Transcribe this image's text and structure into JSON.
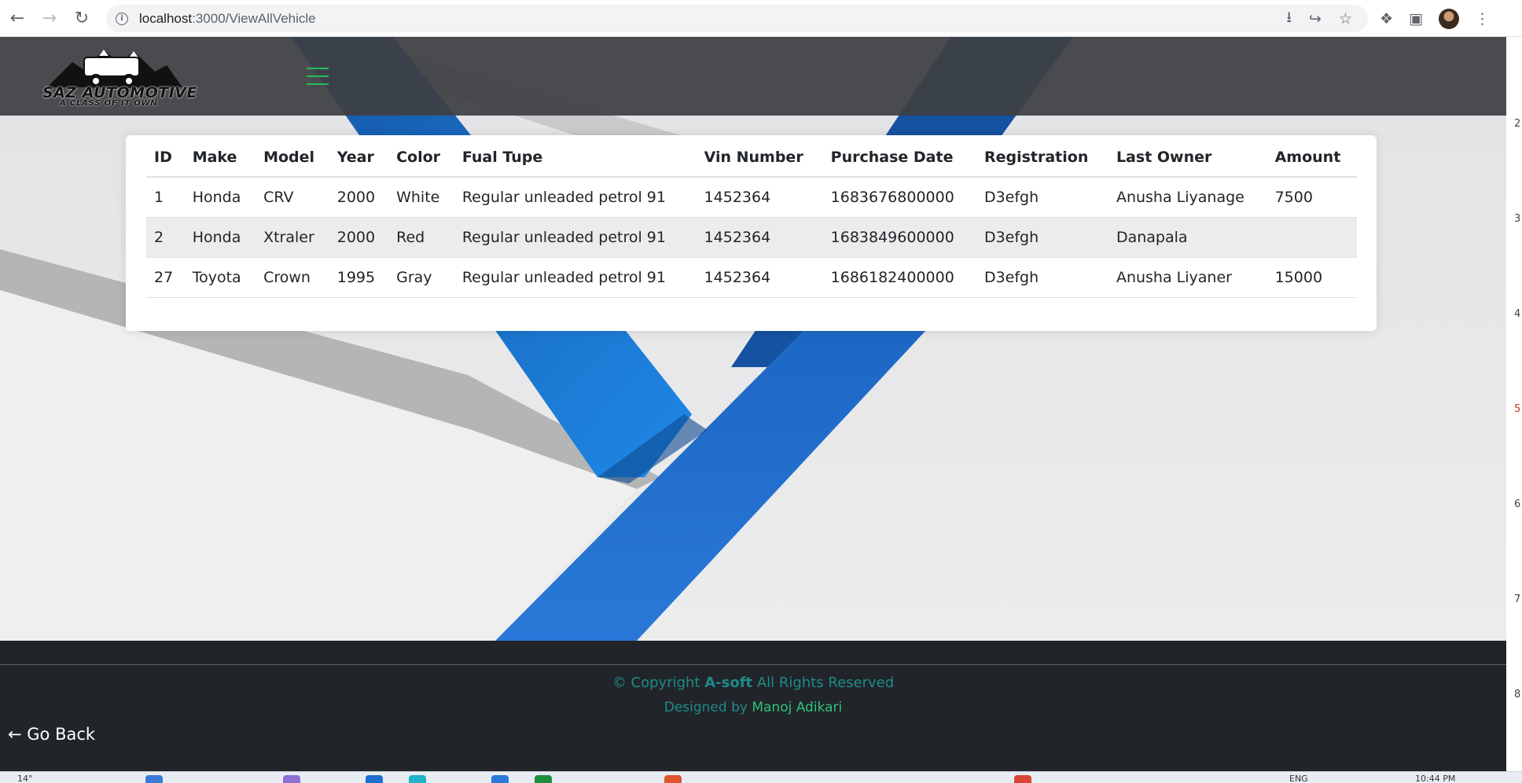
{
  "browser": {
    "url_host": "localhost",
    "url_path": ":3000/ViewAllVehicle"
  },
  "brand": {
    "title": "SAZ AUTOMOTIVE",
    "tagline": "A CLASS OF IT OWN"
  },
  "table": {
    "headers": [
      "ID",
      "Make",
      "Model",
      "Year",
      "Color",
      "Fual Tupe",
      "Vin Number",
      "Purchase Date",
      "Registration",
      "Last Owner",
      "Amount"
    ],
    "rows": [
      [
        "1",
        "Honda",
        "CRV",
        "2000",
        "White",
        "Regular unleaded petrol 91",
        "1452364",
        "1683676800000",
        "D3efgh",
        "Anusha Liyanage",
        "7500"
      ],
      [
        "2",
        "Honda",
        "Xtraler",
        "2000",
        "Red",
        "Regular unleaded petrol 91",
        "1452364",
        "1683849600000",
        "D3efgh",
        "Danapala",
        ""
      ],
      [
        "27",
        "Toyota",
        "Crown",
        "1995",
        "Gray",
        "Regular unleaded petrol 91",
        "1452364",
        "1686182400000",
        "D3efgh",
        "Anusha Liyaner",
        "15000"
      ]
    ]
  },
  "footer": {
    "copyright_prefix": "© Copyright ",
    "company": "A-soft",
    "copyright_suffix": " All Rights Reserved",
    "designed_by": "Designed by ",
    "designer": "Manoj Adikari",
    "go_back": "← Go Back"
  },
  "side_numbers": [
    "2",
    "3",
    "4",
    "5",
    "6",
    "7",
    "8"
  ],
  "taskbar": {
    "temp": "14°",
    "lang": "ENG",
    "time": "10:44 PM"
  },
  "colors": {
    "header_bg": "#3e4043",
    "footer_bg": "#212529",
    "accent_green": "#2ec27e",
    "stripe_blue": "#1a73d9"
  }
}
